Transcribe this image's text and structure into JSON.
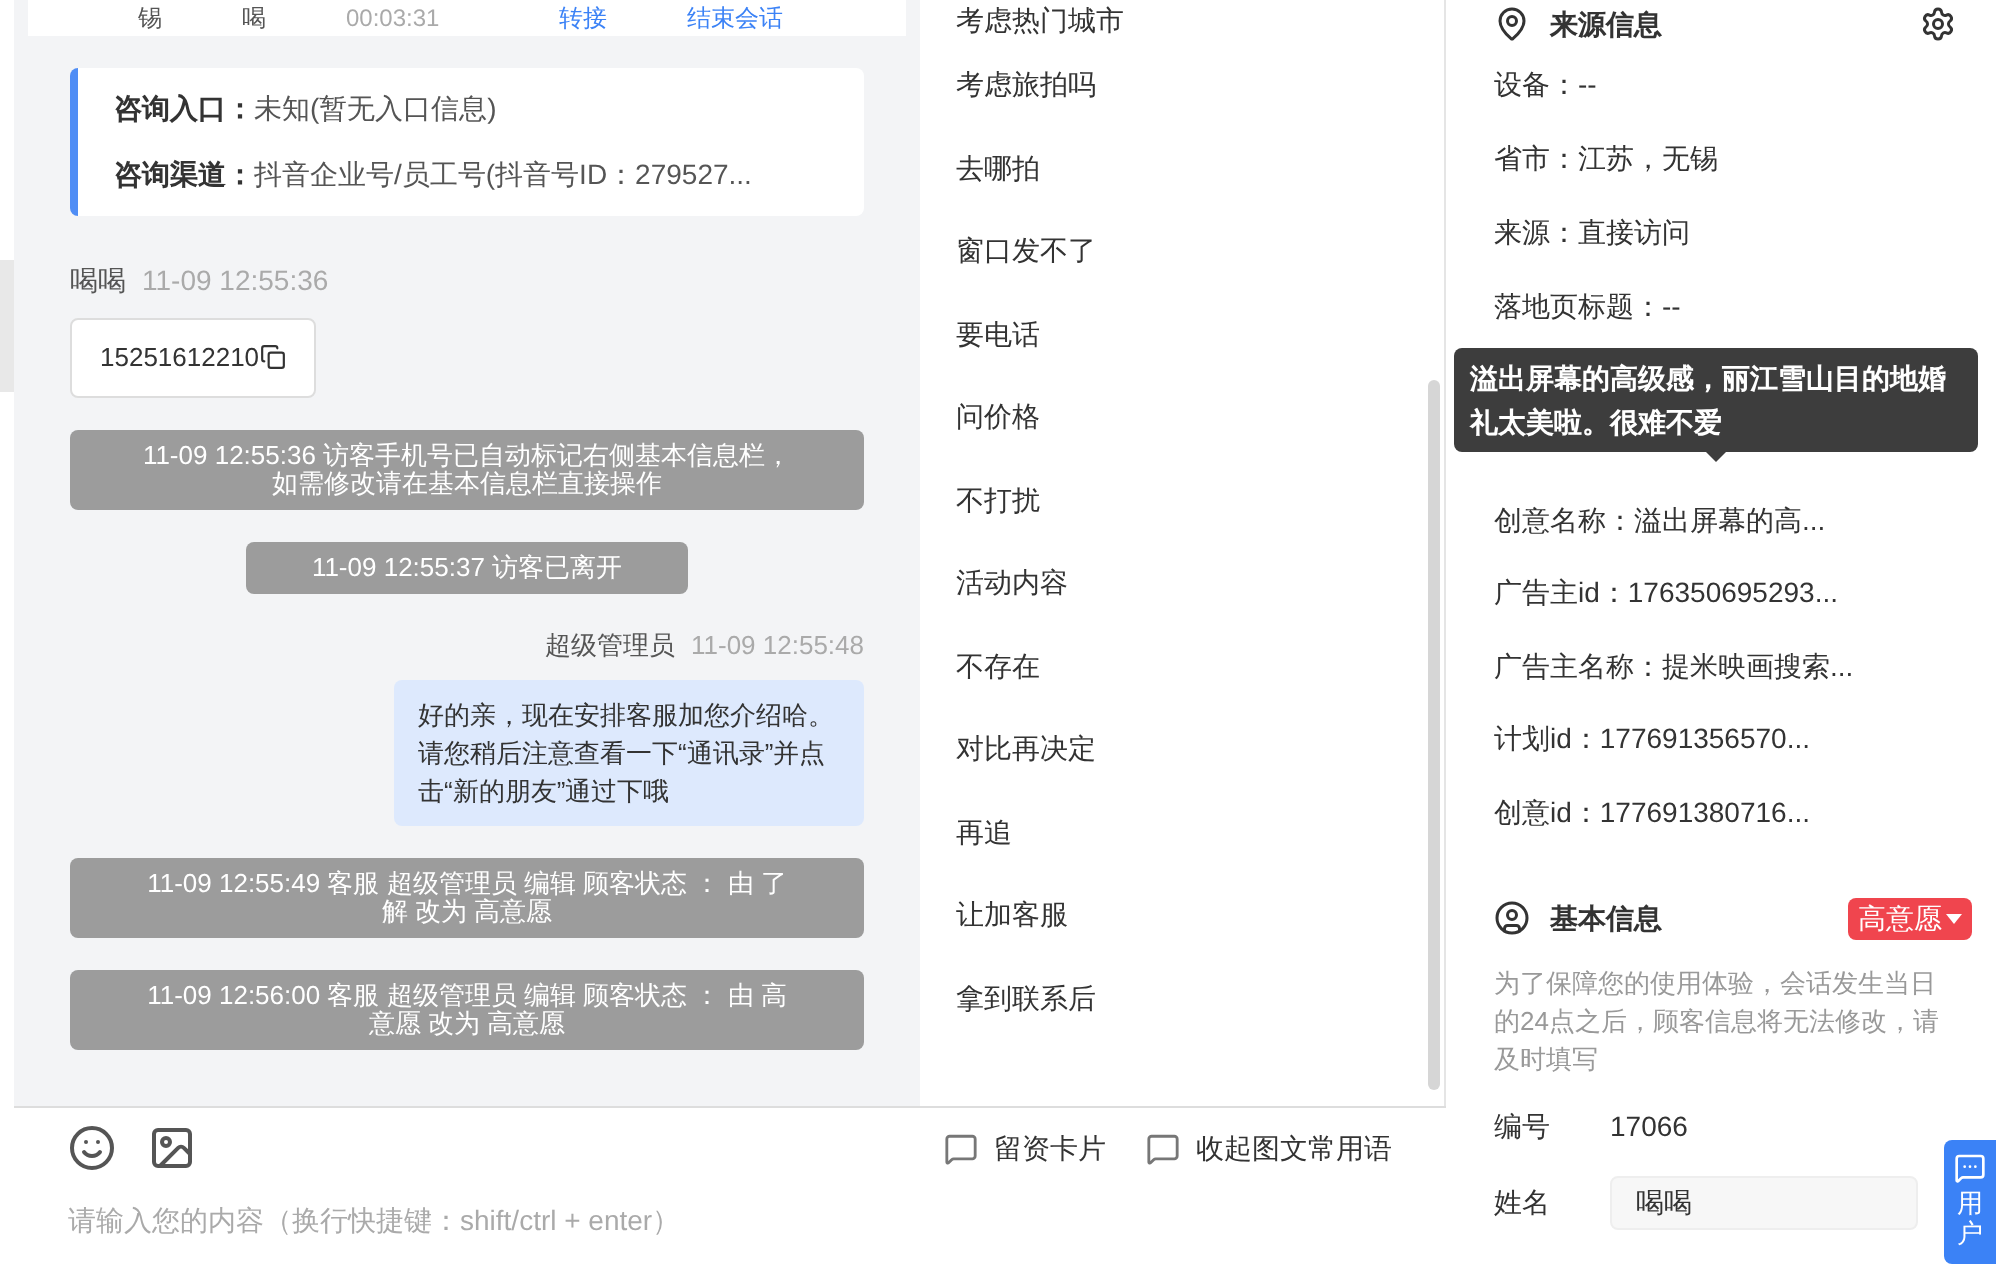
{
  "header": {
    "visitor": "锡",
    "agent": "喝",
    "duration": "00:03:31",
    "actions": [
      "转接",
      "结束会话"
    ]
  },
  "consult": [
    {
      "label": "咨询入口：",
      "value": "未知(暂无入口信息)"
    },
    {
      "label": "咨询渠道：",
      "value": "抖音企业号/员工号(抖音号ID：279527..."
    }
  ],
  "messages": [
    {
      "kind": "visitor",
      "sender": "喝喝",
      "time": "11-09 12:55:36",
      "text": "15251612210"
    },
    {
      "kind": "system",
      "text": "11-09 12:55:36 访客手机号已自动标记右侧基本信息栏，如需修改请在基本信息栏直接操作"
    },
    {
      "kind": "system",
      "text": "11-09 12:55:37 访客已离开"
    },
    {
      "kind": "agent",
      "sender": "超级管理员",
      "time": "11-09 12:55:48",
      "text": "好的亲，现在安排客服加您介绍哈。请您稍后注意查看一下“通讯录”并点击“新的朋友”通过下哦"
    },
    {
      "kind": "system",
      "text": "11-09 12:55:49 客服 超级管理员 编辑 顾客状态 ： 由 了解 改为 高意愿"
    },
    {
      "kind": "system",
      "text": "11-09 12:56:00 客服 超级管理员 编辑 顾客状态 ： 由 高意愿 改为 高意愿"
    }
  ],
  "phrases": [
    "考虑热门城市",
    "考虑旅拍吗",
    "去哪拍",
    "窗口发不了",
    "要电话",
    "问价格",
    "不打扰",
    "活动内容",
    "不存在",
    "对比再决定",
    "再追",
    "让加客服",
    "拿到联系后"
  ],
  "input": {
    "placeholder": "请输入您的内容（换行快捷键：shift/ctrl + enter）",
    "tools": [
      "留资卡片",
      "收起图文常用语"
    ]
  },
  "source": {
    "title": "来源信息",
    "rows": [
      "设备：--",
      "省市：江苏，无锡",
      "来源：直接访问",
      "落地页标题：--"
    ],
    "tooltip": "溢出屏幕的高级感，丽江雪山目的地婚礼太美啦。很难不爱",
    "rows_after": [
      "创意名称：溢出屏幕的高...",
      "广告主id：176350695293...",
      "广告主名称：提米映画搜索...",
      "计划id：177691356570...",
      "创意id：177691380716..."
    ]
  },
  "basic": {
    "title": "基本信息",
    "status": "高意愿",
    "notice": "为了保障您的使用体验，会话发生当日的24点之后，顾客信息将无法修改，请及时填写",
    "fields": [
      {
        "kind": "text",
        "label": "编号",
        "value": "17066"
      },
      {
        "kind": "input",
        "label": "姓名",
        "value": "喝喝"
      }
    ]
  },
  "float_button": "用户"
}
